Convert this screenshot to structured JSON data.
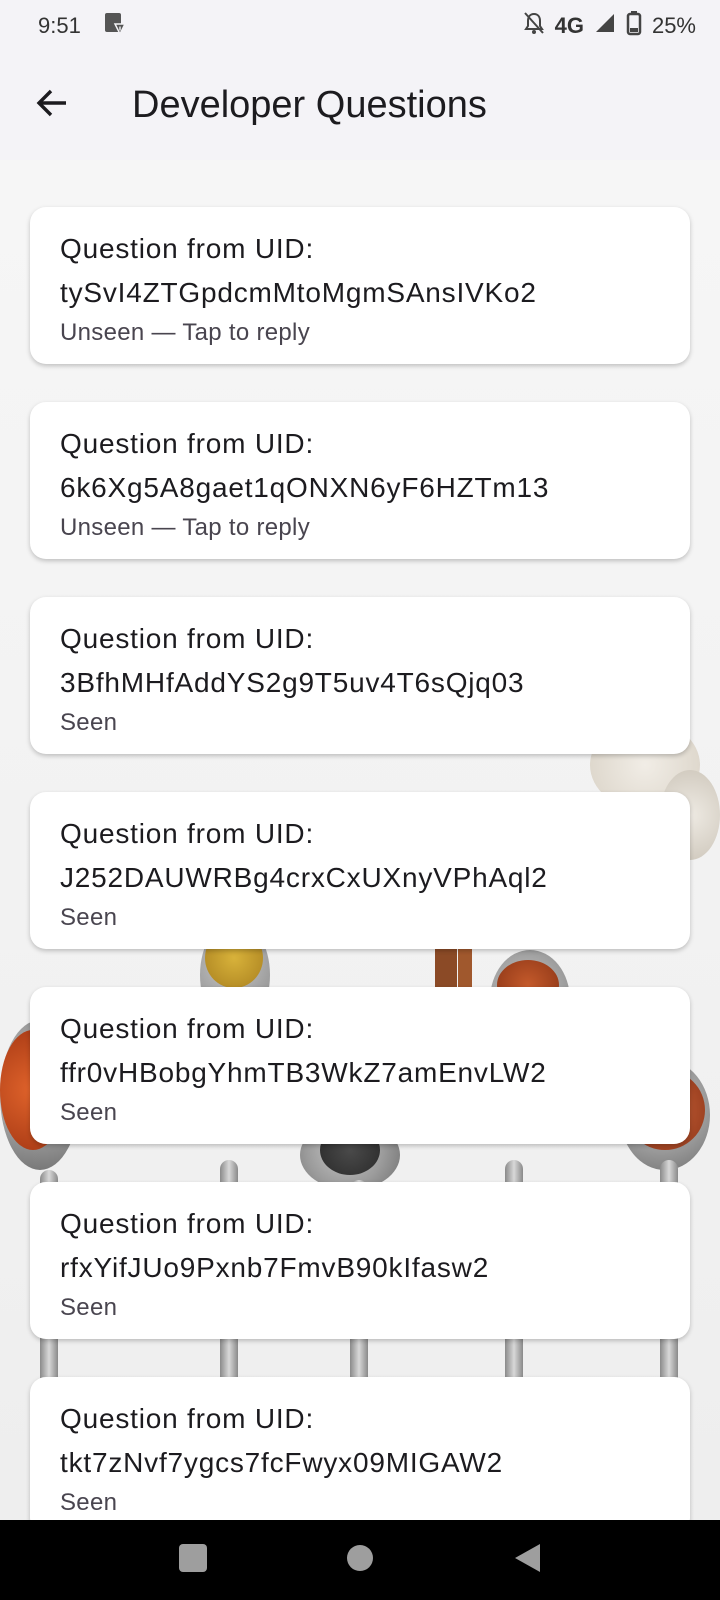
{
  "status_bar": {
    "time": "9:51",
    "network": "4G",
    "battery": "25%",
    "icons": [
      "sim-card-alert-icon",
      "bell-off-icon",
      "signal-icon",
      "battery-icon"
    ]
  },
  "app_bar": {
    "title": "Developer Questions",
    "back_icon": "arrow-back-icon"
  },
  "questions": [
    {
      "label": "Question from UID:",
      "uid": "tySvI4ZTGpdcmMtoMgmSAnsIVKo2",
      "status": "Unseen — Tap to reply"
    },
    {
      "label": "Question from UID:",
      "uid": "6k6Xg5A8gaet1qONXN6yF6HZTm13",
      "status": "Unseen — Tap to reply"
    },
    {
      "label": "Question from UID:",
      "uid": "3BfhMHfAddYS2g9T5uv4T6sQjq03",
      "status": "Seen"
    },
    {
      "label": "Question from UID:",
      "uid": "J252DAUWRBg4crxCxUXnyVPhAql2",
      "status": "Seen"
    },
    {
      "label": "Question from UID:",
      "uid": "ffr0vHBobgYhmTB3WkZ7amEnvLW2",
      "status": "Seen"
    },
    {
      "label": "Question from UID:",
      "uid": "rfxYifJUo9Pxnb7FmvB90kIfasw2",
      "status": "Seen"
    },
    {
      "label": "Question from UID:",
      "uid": "tkt7zNvf7ygcs7fcFwyx09MIGAW2",
      "status": "Seen"
    }
  ],
  "nav_bar": {
    "icons": [
      "recents-square-icon",
      "home-circle-icon",
      "back-triangle-icon"
    ]
  }
}
